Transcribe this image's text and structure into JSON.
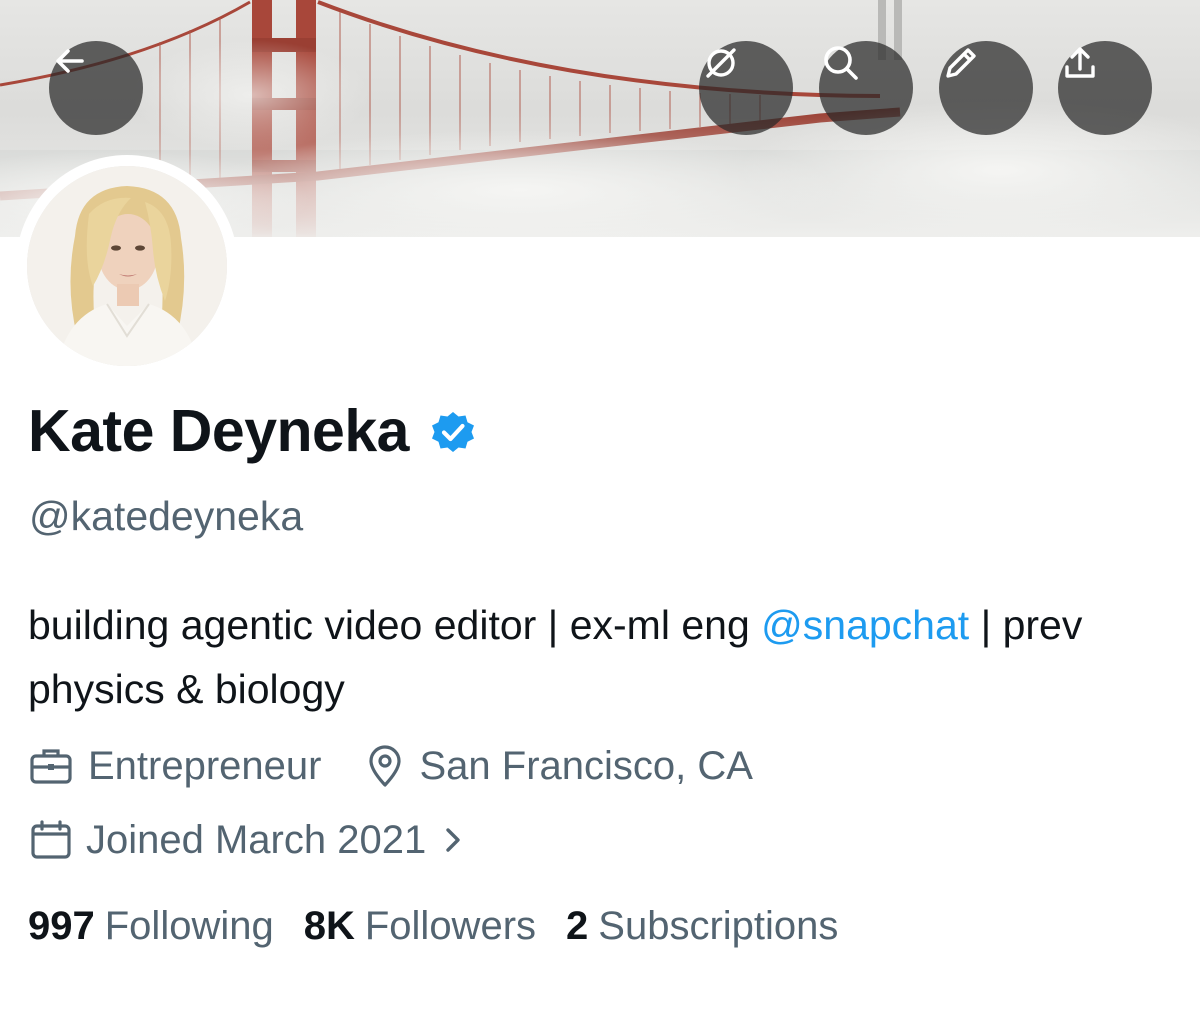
{
  "header": {
    "buttons": [
      {
        "name": "back-arrow-icon"
      },
      {
        "name": "grok-icon"
      },
      {
        "name": "search-icon"
      },
      {
        "name": "pencil-icon"
      },
      {
        "name": "share-icon"
      }
    ]
  },
  "profile": {
    "name": "Kate Deyneka",
    "verified": true,
    "handle": "@katedeyneka",
    "bio": {
      "text_1": "building agentic video editor | ex-ml eng ",
      "mention": "@snapchat",
      "text_2": " | prev physics & biology"
    },
    "profession": "Entrepreneur",
    "location": "San Francisco, CA",
    "joined": "Joined March 2021"
  },
  "stats": {
    "following_count": "997",
    "following_label": "Following",
    "followers_count": "8K",
    "followers_label": "Followers",
    "subscriptions_count": "2",
    "subscriptions_label": "Subscriptions"
  },
  "colors": {
    "accent": "#1d9bf0",
    "verified_badge": "#1d9bf0",
    "secondary_text": "#536471",
    "primary_text": "#0f1419",
    "bridge": "#a8473a"
  }
}
